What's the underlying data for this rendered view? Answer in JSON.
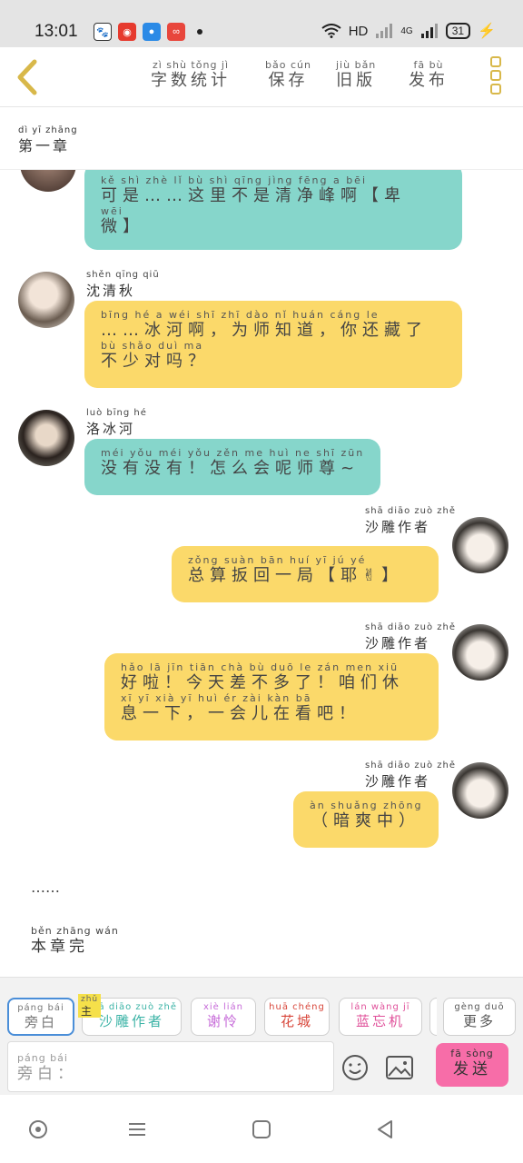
{
  "status_bar": {
    "time": "13:01",
    "network": "HD",
    "signal": "4G",
    "battery": "31"
  },
  "toolbar": {
    "word_count": {
      "pinyin": "zì shù tǒng jì",
      "label": "字数统计"
    },
    "save": {
      "pinyin": "bǎo cún",
      "label": "保存"
    },
    "old_version": {
      "pinyin": "jiù bǎn",
      "label": "旧版"
    },
    "publish": {
      "pinyin": "fā bù",
      "label": "发布"
    }
  },
  "chapter": {
    "pinyin": "dì yī zhāng",
    "title": "第一章"
  },
  "messages": [
    {
      "speaker": "",
      "speaker_pinyin": "",
      "side": "left",
      "color": "#86d6cb",
      "lines": [
        {
          "pinyin": "kě shì       zhè lǐ  bù shì qīng jìng fēng  a     bēi",
          "text": "可是……这里不是清净峰啊【卑"
        },
        {
          "pinyin": "wēi",
          "text": "微】"
        }
      ]
    },
    {
      "speaker": "沈清秋",
      "speaker_pinyin": "shěn qīng qiū",
      "side": "left",
      "color": "#fbd96a",
      "lines": [
        {
          "pinyin": "      bīng hé  a      wéi shī zhī dào    nǐ huán cáng le",
          "text": "……冰河啊，为师知道，你还藏了"
        },
        {
          "pinyin": "bù shǎo duì ma",
          "text": "不少对吗？"
        }
      ]
    },
    {
      "speaker": "洛冰河",
      "speaker_pinyin": "luò bīng hé",
      "side": "left",
      "color": "#86d6cb",
      "lines": [
        {
          "pinyin": "méi yǒu méi yǒu    zěn me huì ne shī zūn",
          "text": "没有没有！怎么会呢师尊~"
        }
      ]
    },
    {
      "speaker": "沙雕作者",
      "speaker_pinyin": "shā diāo zuò zhě",
      "side": "right",
      "color": "#fbd96a",
      "lines": [
        {
          "pinyin": "zǒng suàn bān huí  yī  jú      yé",
          "text": "总算扳回一局【耶✌】"
        }
      ]
    },
    {
      "speaker": "沙雕作者",
      "speaker_pinyin": "shā diāo zuò zhě",
      "side": "right",
      "color": "#fbd96a",
      "lines": [
        {
          "pinyin": "hǎo  lā    jīn tiān chà  bù duō  le    zán men xiū",
          "text": "好啦！今天差不多了！咱们休"
        },
        {
          "pinyin": "xī  yī  xià     yī  huì  ér  zài kàn  bā",
          "text": "息一下，一会儿在看吧！"
        }
      ]
    },
    {
      "speaker": "沙雕作者",
      "speaker_pinyin": "shā diāo zuò zhě",
      "side": "right",
      "color": "#fbd96a",
      "lines": [
        {
          "pinyin": "àn shuǎng zhōng",
          "text": "（暗爽中）"
        }
      ]
    }
  ],
  "ellipsis": "……",
  "chapter_end": {
    "pinyin": "běn zhāng wán",
    "text": "本章完"
  },
  "roles": [
    {
      "pinyin": "páng bái",
      "label": "旁白",
      "color": "#777777"
    },
    {
      "pinyin": "shā diāo zuò zhě",
      "label": "沙雕作者",
      "color": "#3bb3a6"
    },
    {
      "pinyin": "xiè lián",
      "label": "谢怜",
      "color": "#c66ad8"
    },
    {
      "pinyin": "huā chéng",
      "label": "花城",
      "color": "#d8463a"
    },
    {
      "pinyin": "lán wàng jī",
      "label": "蓝忘机",
      "color": "#e0509a"
    },
    {
      "pinyin": "gèng duō",
      "label": "更多",
      "color": "#555555"
    }
  ],
  "host_tag": {
    "pinyin": "zhǔ",
    "label": "主"
  },
  "input": {
    "pinyin": "páng bái",
    "placeholder": "旁白："
  },
  "send": {
    "pinyin": "fā sòng",
    "label": "发送"
  },
  "colors": {
    "teal": "#86d6cb",
    "yellow": "#fbd96a",
    "send": "#f76da8",
    "accent": "#d8b84a"
  }
}
